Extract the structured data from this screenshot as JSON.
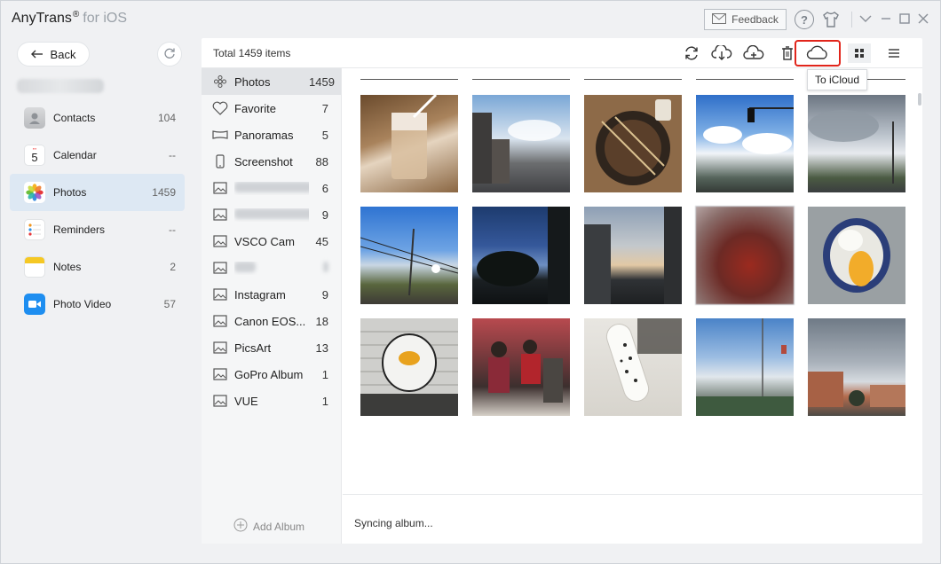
{
  "app": {
    "name": "AnyTrans",
    "reg": "®",
    "suffix": "for iOS"
  },
  "titlebar": {
    "feedback_label": "Feedback"
  },
  "sidebar": {
    "back_label": "Back",
    "items": [
      {
        "label": "Contacts",
        "count": "104",
        "icon": "contacts-icon"
      },
      {
        "label": "Calendar",
        "count": "--",
        "icon": "calendar-icon",
        "day": "5"
      },
      {
        "label": "Photos",
        "count": "1459",
        "icon": "photos-icon",
        "active": true
      },
      {
        "label": "Reminders",
        "count": "--",
        "icon": "reminders-icon"
      },
      {
        "label": "Notes",
        "count": "2",
        "icon": "notes-icon"
      },
      {
        "label": "Photo Video",
        "count": "57",
        "icon": "video-icon"
      }
    ]
  },
  "main": {
    "total_label": "Total 1459 items",
    "tooltip": "To iCloud",
    "status": "Syncing album...",
    "add_album_label": "Add Album",
    "albums": [
      {
        "label": "Photos",
        "count": "1459"
      },
      {
        "label": "Favorite",
        "count": "7"
      },
      {
        "label": "Panoramas",
        "count": "5"
      },
      {
        "label": "Screenshot",
        "count": "88"
      },
      {
        "label": "",
        "count": "6"
      },
      {
        "label": "",
        "count": "9"
      },
      {
        "label": "VSCO Cam",
        "count": "45"
      },
      {
        "label": "",
        "count": ""
      },
      {
        "label": "Instagram",
        "count": "9"
      },
      {
        "label": "Canon EOS...",
        "count": "18"
      },
      {
        "label": "PicsArt",
        "count": "13"
      },
      {
        "label": "GoPro Album",
        "count": "1"
      },
      {
        "label": "VUE",
        "count": "1"
      }
    ]
  },
  "colors": {
    "accent": "#e1251b",
    "active_bg": "#dde8f3",
    "panel_bg": "#f5f6f7"
  }
}
